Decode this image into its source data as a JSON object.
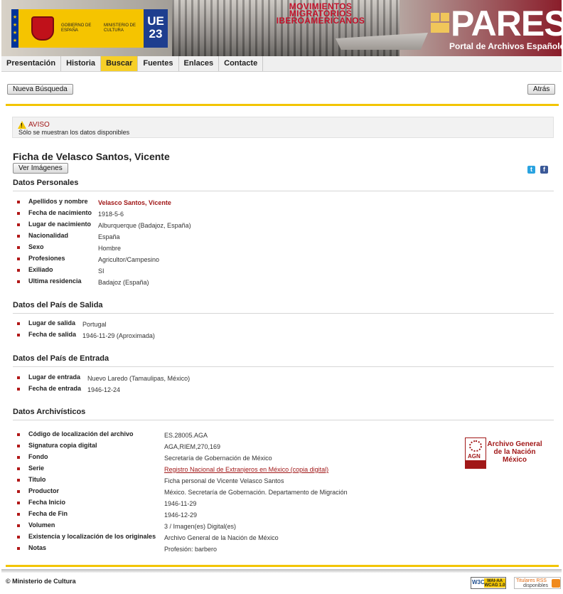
{
  "header": {
    "gov_text": "GOBIERNO DE ESPAÑA",
    "ministry_text": "MINISTERIO DE CULTURA",
    "ue_badge": "UE 23",
    "movimientos_line1": "MOVIMIENTOS",
    "movimientos_line2": "MIGRATORIOS",
    "movimientos_line3": "IBEROAMERICANOS",
    "pares_word": "PARES",
    "pares_subtitle": "Portal de Archivos Españoles"
  },
  "nav": {
    "items": [
      "Presentación",
      "Historia",
      "Buscar",
      "Fuentes",
      "Enlaces",
      "Contacte"
    ],
    "active": "Buscar"
  },
  "toolbar": {
    "new_search_label": "Nueva Búsqueda",
    "back_label": "Atrás"
  },
  "aviso": {
    "title": "AVISO",
    "message": "Sólo se muestran los datos disponibles"
  },
  "ficha": {
    "title": "Ficha de Velasco Santos, Vicente",
    "ver_imagenes_label": "Ver Imágenes"
  },
  "sections": {
    "personales": {
      "title": "Datos Personales",
      "rows": [
        {
          "label": "Apellidos y nombre",
          "value": "Velasco Santos, Vicente"
        },
        {
          "label": "Fecha de nacimiento",
          "value": "1918-5-6"
        },
        {
          "label": "Lugar de nacimiento",
          "value": "Alburquerque (Badajoz, España)"
        },
        {
          "label": "Nacionalidad",
          "value": "España"
        },
        {
          "label": "Sexo",
          "value": "Hombre"
        },
        {
          "label": "Profesiones",
          "value": "Agricultor/Campesino"
        },
        {
          "label": "Exiliado",
          "value": "SI"
        },
        {
          "label": "Ultima residencia",
          "value": "Badajoz (España)"
        }
      ]
    },
    "salida": {
      "title": "Datos del País de Salida",
      "rows": [
        {
          "label": "Lugar de salida",
          "value": "Portugal"
        },
        {
          "label": "Fecha de salida",
          "value": "1946-11-29 (Aproximada)"
        }
      ]
    },
    "entrada": {
      "title": "Datos del País de Entrada",
      "rows": [
        {
          "label": "Lugar de entrada",
          "value": "Nuevo Laredo (Tamaulipas, México)"
        },
        {
          "label": "Fecha de entrada",
          "value": "1946-12-24"
        }
      ]
    },
    "archivisticos": {
      "title": "Datos Archivísticos",
      "rows": [
        {
          "label": "Código de localización del archivo",
          "value": "ES.28005.AGA"
        },
        {
          "label": "Signatura copia digital",
          "value": "AGA,RIEM,270,169"
        },
        {
          "label": "Fondo",
          "value": "Secretaría de Gobernación de México"
        },
        {
          "label": "Serie",
          "value": "Registro Nacional de Extranjeros en México (copia digital)"
        },
        {
          "label": "Titulo",
          "value": "Ficha personal de Vicente Velasco Santos"
        },
        {
          "label": "Productor",
          "value": "México. Secretaría de Gobernación. Departamento de Migración"
        },
        {
          "label": "Fecha Inicio",
          "value": "1946-11-29"
        },
        {
          "label": "Fecha de Fin",
          "value": "1946-12-29"
        },
        {
          "label": "Volumen",
          "value": "3 / Imagen(es) Digital(es)"
        },
        {
          "label": "Existencia y localización de los originales",
          "value": "Archivo General de la Nación de México"
        },
        {
          "label": "Notas",
          "value": "Profesión: barbero"
        }
      ]
    }
  },
  "agn_logo": {
    "abbr": "AGN",
    "line1": "Archivo General",
    "line2": "de la Nación",
    "line3": "México"
  },
  "footer": {
    "copyright": "© Ministerio de Cultura",
    "wai_w3c": "W3C",
    "wai_level": "WAI-AA WCAG 1.0",
    "rss_line1": "Titulares RSS",
    "rss_line2": "disponibles"
  }
}
